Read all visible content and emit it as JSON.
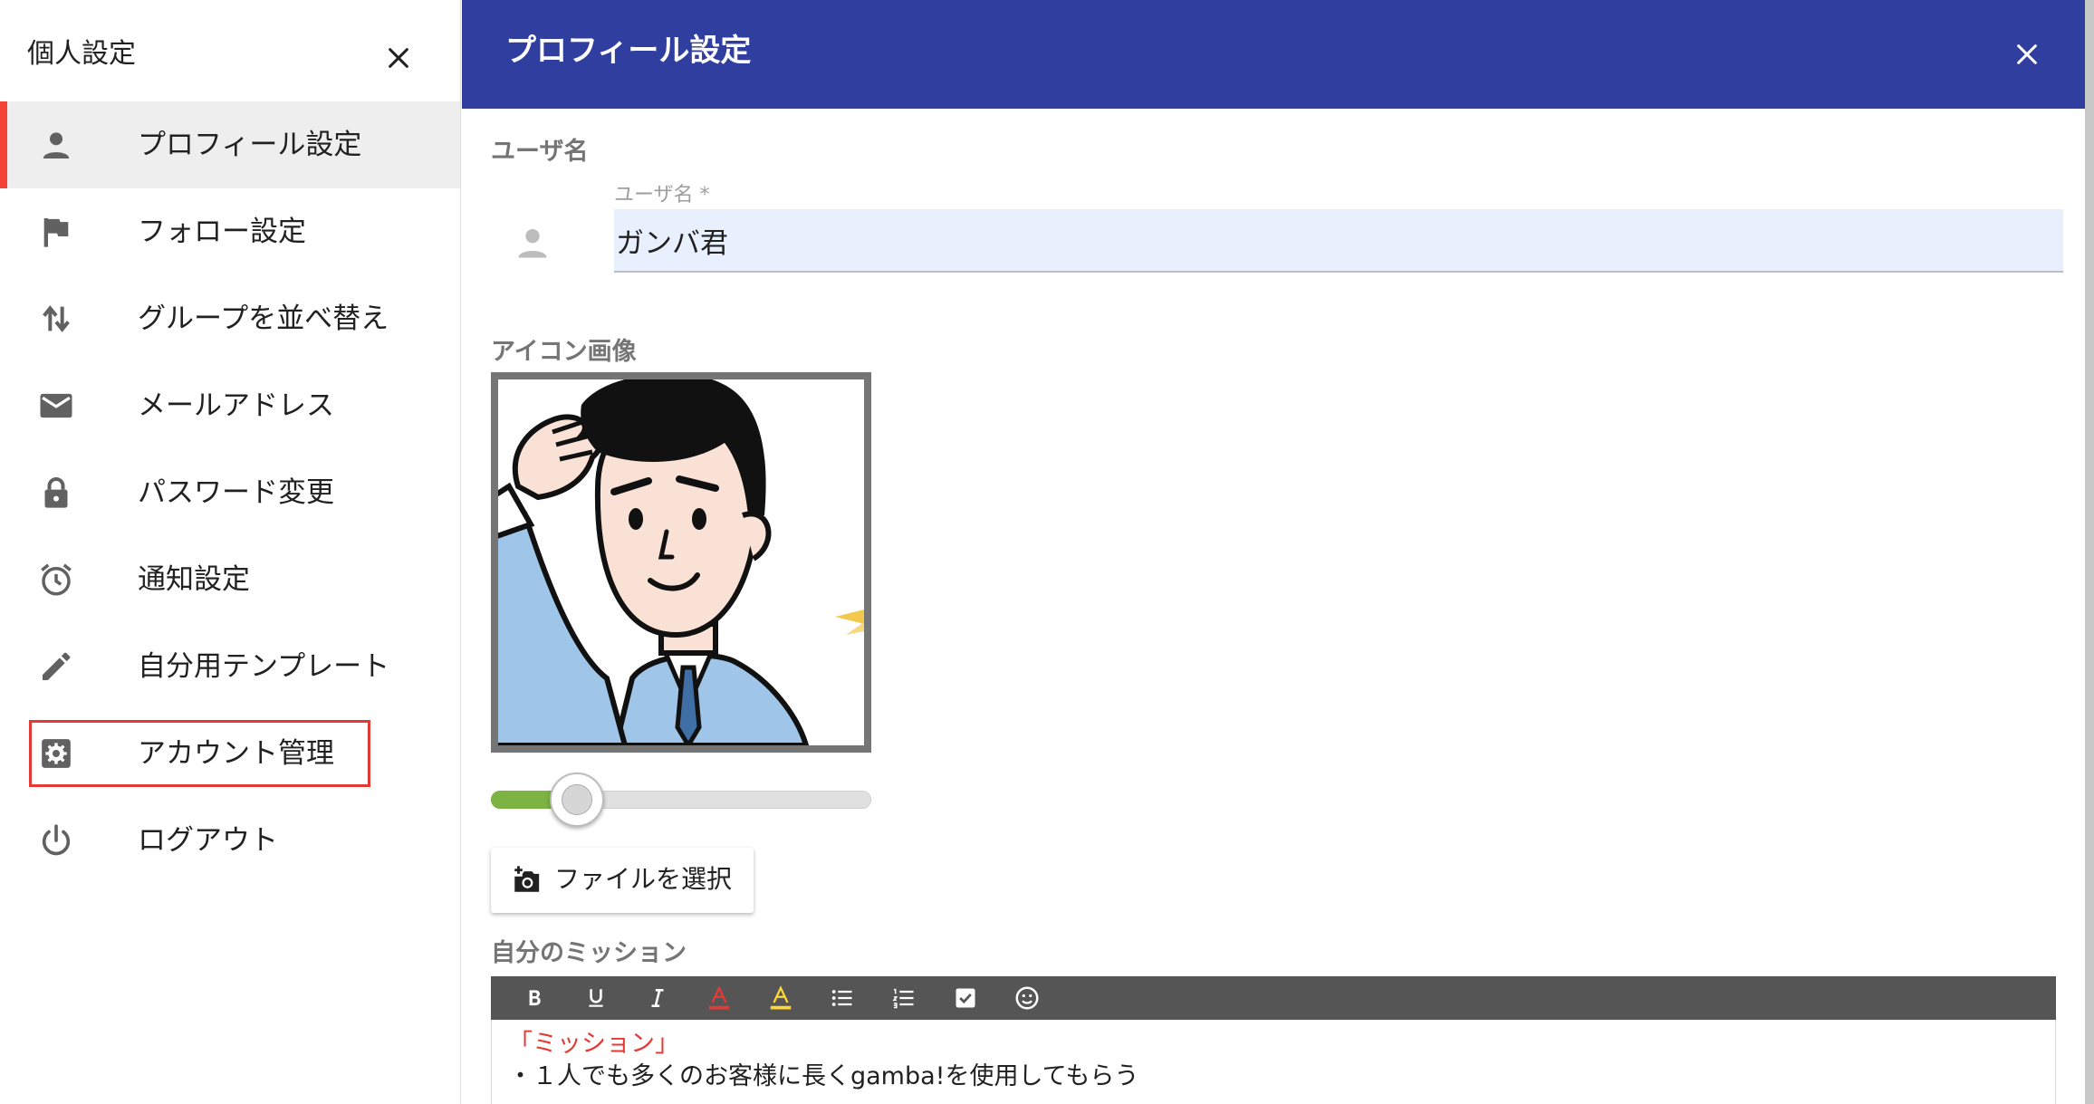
{
  "sidebar": {
    "title": "個人設定",
    "items": [
      {
        "label": "プロフィール設定",
        "icon": "person-icon",
        "active": true
      },
      {
        "label": "フォロー設定",
        "icon": "flag-icon"
      },
      {
        "label": "グループを並べ替え",
        "icon": "swap-vertical-icon"
      },
      {
        "label": "メールアドレス",
        "icon": "mail-icon"
      },
      {
        "label": "パスワード変更",
        "icon": "lock-icon"
      },
      {
        "label": "通知設定",
        "icon": "alarm-icon"
      },
      {
        "label": "自分用テンプレート",
        "icon": "pencil-icon"
      },
      {
        "label": "アカウント管理",
        "icon": "gear-icon",
        "highlighted": true
      },
      {
        "label": "ログアウト",
        "icon": "power-icon"
      }
    ]
  },
  "main": {
    "title": "プロフィール設定",
    "username": {
      "section_label": "ユーザ名",
      "field_label": "ユーザ名 *",
      "value": "ガンバ君"
    },
    "icon_image": {
      "section_label": "アイコン画像",
      "zoom_fraction": 0.18,
      "file_button_label": "ファイルを選択"
    },
    "mission": {
      "section_label": "自分のミッション",
      "toolbar": [
        "bold",
        "underline",
        "italic",
        "text-color",
        "highlight-color",
        "bulleted-list",
        "numbered-list",
        "checkbox",
        "emoji"
      ],
      "line1": "「ミッション」",
      "line2": "・１人でも多くのお客様に長くgamba!を使用してもらう"
    }
  },
  "colors": {
    "header": "#303f9f",
    "active_indicator": "#f44336",
    "highlight_border": "#e53935",
    "slider_fill": "#7cb342",
    "toolbar_bg": "#555555",
    "mission_heading": "#e53935"
  }
}
